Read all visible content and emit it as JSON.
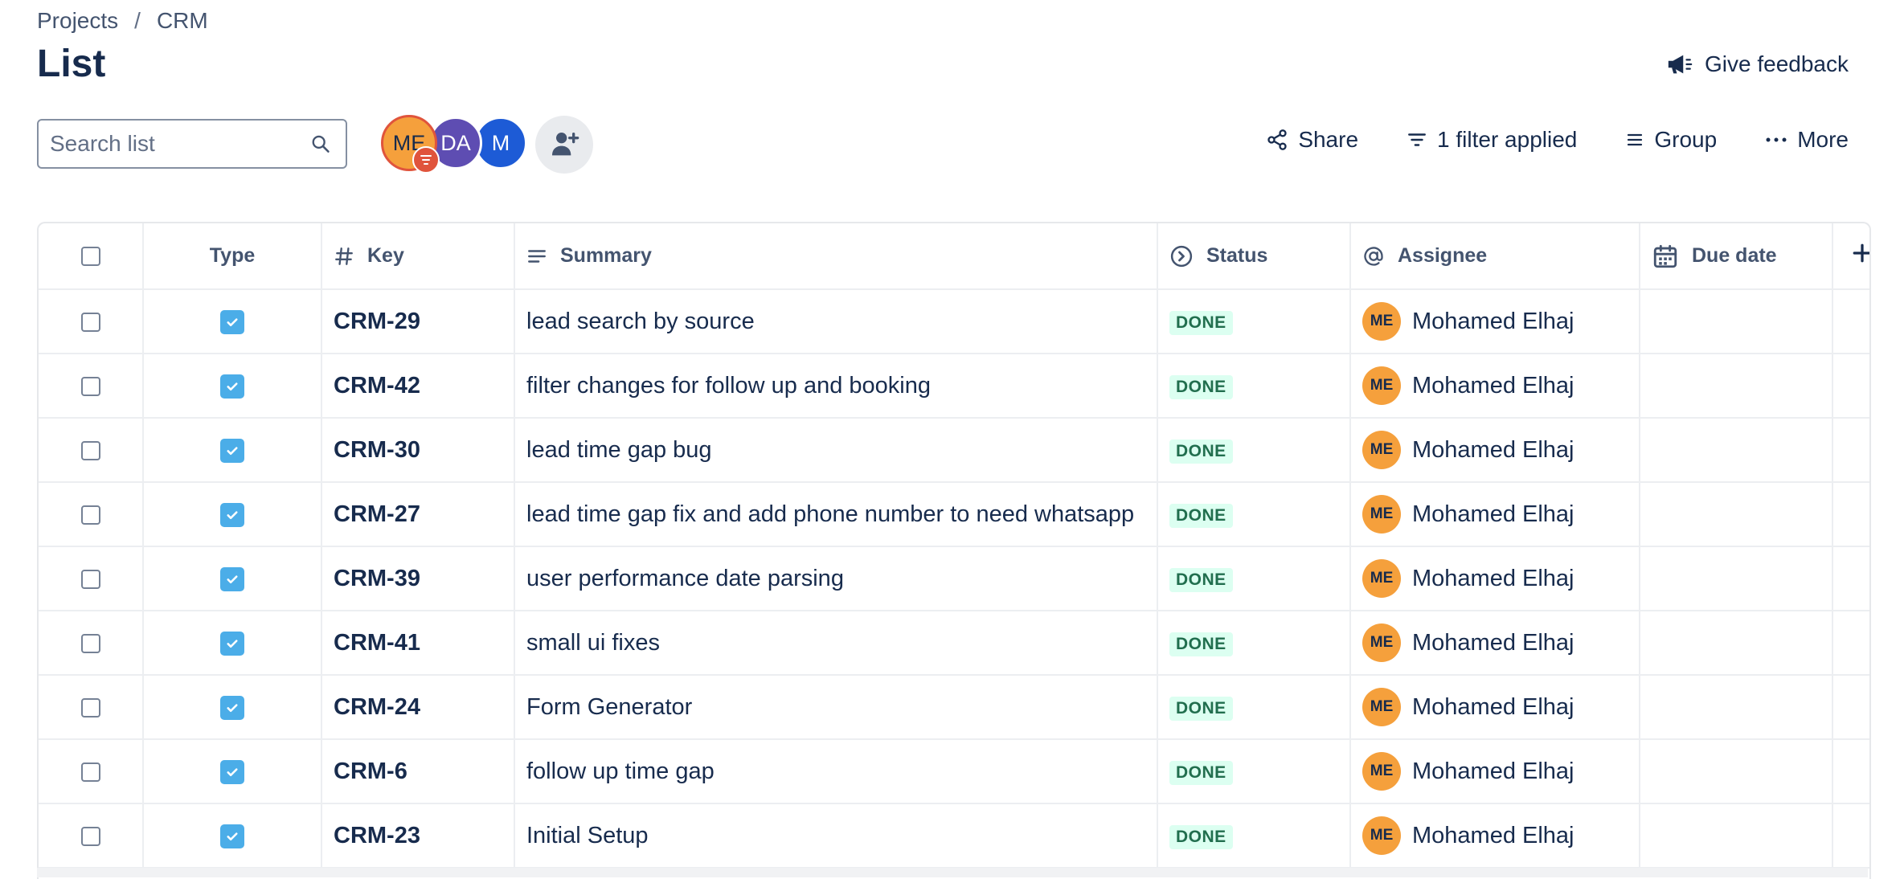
{
  "breadcrumb": {
    "projects": "Projects",
    "separator": "/",
    "project": "CRM"
  },
  "page_title": "List",
  "feedback_label": "Give feedback",
  "search": {
    "placeholder": "Search list",
    "value": ""
  },
  "avatars": [
    {
      "initials": "ME",
      "color": "#f5a03c"
    },
    {
      "initials": "DA",
      "color": "#5e4db2"
    },
    {
      "initials": "M",
      "color": "#1d5bd6"
    }
  ],
  "toolbar": {
    "share_label": "Share",
    "filter_label": "1 filter applied",
    "group_label": "Group",
    "more_label": "More"
  },
  "columns": {
    "type": "Type",
    "key": "Key",
    "summary": "Summary",
    "status": "Status",
    "assignee": "Assignee",
    "due_date": "Due date"
  },
  "rows": [
    {
      "key": "CRM-29",
      "summary": "lead search by source",
      "status": "DONE",
      "assignee_initials": "ME",
      "assignee": "Mohamed Elhaj",
      "due_date": ""
    },
    {
      "key": "CRM-42",
      "summary": "filter changes for follow up and booking",
      "status": "DONE",
      "assignee_initials": "ME",
      "assignee": "Mohamed Elhaj",
      "due_date": ""
    },
    {
      "key": "CRM-30",
      "summary": "lead time gap bug",
      "status": "DONE",
      "assignee_initials": "ME",
      "assignee": "Mohamed Elhaj",
      "due_date": ""
    },
    {
      "key": "CRM-27",
      "summary": "lead time gap fix and add phone number to need whatsapp",
      "status": "DONE",
      "assignee_initials": "ME",
      "assignee": "Mohamed Elhaj",
      "due_date": ""
    },
    {
      "key": "CRM-39",
      "summary": "user performance date parsing",
      "status": "DONE",
      "assignee_initials": "ME",
      "assignee": "Mohamed Elhaj",
      "due_date": ""
    },
    {
      "key": "CRM-41",
      "summary": "small ui fixes",
      "status": "DONE",
      "assignee_initials": "ME",
      "assignee": "Mohamed Elhaj",
      "due_date": ""
    },
    {
      "key": "CRM-24",
      "summary": "Form Generator",
      "status": "DONE",
      "assignee_initials": "ME",
      "assignee": "Mohamed Elhaj",
      "due_date": ""
    },
    {
      "key": "CRM-6",
      "summary": "follow up time gap",
      "status": "DONE",
      "assignee_initials": "ME",
      "assignee": "Mohamed Elhaj",
      "due_date": ""
    },
    {
      "key": "CRM-23",
      "summary": "Initial Setup",
      "status": "DONE",
      "assignee_initials": "ME",
      "assignee": "Mohamed Elhaj",
      "due_date": ""
    }
  ],
  "colors": {
    "status_done_bg": "#dcfff1",
    "status_done_text": "#216e4e",
    "task_icon": "#4bade8",
    "assignee_avatar": "#f5a03c"
  }
}
